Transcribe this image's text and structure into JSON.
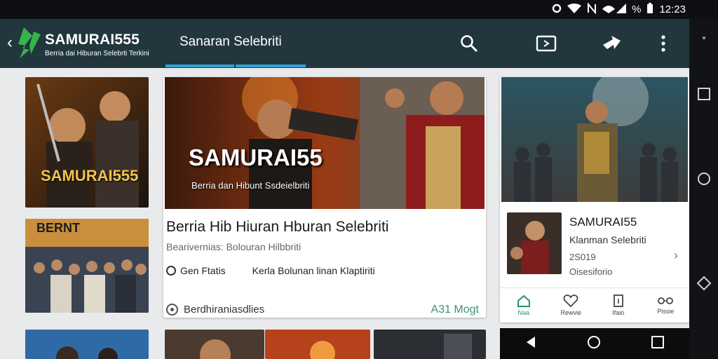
{
  "status_bar": {
    "time": "12:23",
    "battery_text": "%",
    "icons": [
      "notification-icon",
      "wifi-icon",
      "nfc-icon",
      "signal-icon",
      "battery-icon"
    ]
  },
  "app_bar": {
    "brand": "SAMURAI555",
    "tagline": "Berria dai Hiburan Selebrti Terkini",
    "tab_title": "Sanaran Selebriti",
    "icons": [
      "back-icon",
      "search-icon",
      "cast-icon",
      "share-icon",
      "more-icon"
    ]
  },
  "thumbnails": {
    "top_left_label": "SAMURAI555",
    "mid_left_label": "BERNT"
  },
  "featured_card": {
    "hero_title": "SAMURAI55",
    "hero_subtitle": "Berria dan Hibunt Ssdeielbriti",
    "title": "Berria Hib Hiuran Hburan Selebriti",
    "subtitle": "Bearivernias: Bolouran Hilbbriti",
    "meta_left": "Gen Ftatis",
    "meta_right": "Kerla Bolunan linan Klaptiriti",
    "footer_text": "Berdhiraniasdlies",
    "footer_action": "A31 Mogt"
  },
  "side_card": {
    "title": "SAMURAI55",
    "subtitle": "Klanman Selebriti",
    "year": "2S019",
    "views": "Oisesiforio",
    "nav_tabs": [
      {
        "label": "Naa",
        "icon": "home-icon"
      },
      {
        "label": "Rewvie",
        "icon": "heart-icon"
      },
      {
        "label": "Ifaio",
        "icon": "document-icon"
      },
      {
        "label": "Pissie",
        "icon": "glasses-icon"
      }
    ]
  },
  "colors": {
    "app_bar": "#22363e",
    "accent": "#2fa4d6",
    "action_green": "#3d8f7b",
    "logo_green": "#36b34a"
  }
}
